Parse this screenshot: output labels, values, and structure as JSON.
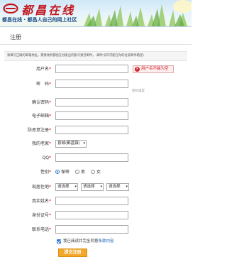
{
  "site": {
    "logo_text": "都昌在线",
    "tagline": "都昌在线 · 都昌人自己的网上社区"
  },
  "page": {
    "title": "注册"
  },
  "notice": "请填写正确的邮箱地址，需要收到都昌在线发出的账号激活邮件。（邮件没有可能在你的垃圾邮件箱里）",
  "form": {
    "username": {
      "label": "用户名",
      "required": true,
      "value": "",
      "error": "用户名不能为空"
    },
    "password": {
      "label": "密　码",
      "required": true,
      "value": "",
      "hint": "密码强度"
    },
    "confirm_password": {
      "label": "确认密码",
      "required": true,
      "value": ""
    },
    "email": {
      "label": "电子邮箱",
      "required": true,
      "value": ""
    },
    "antispam": {
      "label": "防恶意注册",
      "required": true,
      "value": ""
    },
    "hometown": {
      "label": "我的老家",
      "required": true,
      "selected": "县城(都昌镇)"
    },
    "qq": {
      "label": "QQ",
      "required": true,
      "value": ""
    },
    "gender": {
      "label": "性别",
      "required": true,
      "options": [
        "保密",
        "男",
        "女"
      ],
      "selected_index": 0
    },
    "residence": {
      "label": "现居住地",
      "required": true,
      "selects": [
        "请选择",
        "请选择",
        "请选择"
      ]
    },
    "real_name": {
      "label": "真实姓名",
      "required": true,
      "value": ""
    },
    "id_number": {
      "label": "身份证号",
      "required": true,
      "value": ""
    },
    "phone": {
      "label": "联系电话",
      "required": true,
      "value": ""
    }
  },
  "agreement": {
    "text": "我已阅读并完全同意",
    "link": "条款内容",
    "checked": true
  },
  "submit_label": "提交注册",
  "colors": {
    "brand_red": "#c0151c",
    "link_blue": "#1a5fb4",
    "error_red": "#d0212b",
    "submit_orange": "#f2a82a"
  }
}
